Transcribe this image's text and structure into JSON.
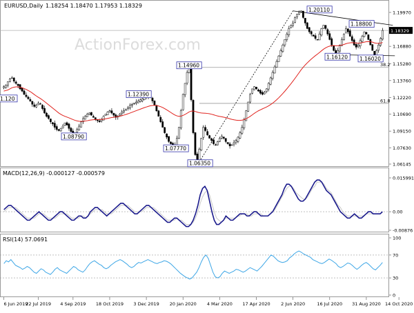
{
  "chart_data": [
    {
      "type": "candlestick",
      "panel": "price",
      "header": {
        "title": "EURUSD,Daily",
        "ohlc": "1.18254 1.18470 1.17953 1.18329"
      },
      "watermark": "ActionForex.com",
      "y_ticks": [
        "1.19970",
        "1.18329",
        "1.16880",
        "1.15280",
        "1.13760",
        "1.12220",
        "1.10690",
        "1.09150",
        "1.07630",
        "1.06145"
      ],
      "current_price_label": "1.18329",
      "ylim": [
        1.06145,
        1.1997
      ],
      "annotations": [
        {
          "text": "1.20110",
          "value": 1.2011
        },
        {
          "text": "1.18800",
          "value": 1.188
        },
        {
          "text": "1.16120",
          "value": 1.1612
        },
        {
          "text": "1.16020",
          "value": 1.1602
        },
        {
          "text": "1.14960",
          "value": 1.1496
        },
        {
          "text": "1.12390",
          "value": 1.1239
        },
        {
          "text": "1.08790",
          "value": 1.0879
        },
        {
          "text": "1.07770",
          "value": 1.0777
        },
        {
          "text": "1.06350",
          "value": 1.0635
        },
        {
          "text": "1.120",
          "value": 1.12
        }
      ],
      "fibonacci": [
        {
          "text": "38.2",
          "value": 1.1496
        },
        {
          "text": "61.8",
          "value": 1.1168
        }
      ],
      "series": [
        {
          "name": "close",
          "values": [
            1.132,
            1.1335,
            1.1365,
            1.139,
            1.14,
            1.137,
            1.135,
            1.133,
            1.13,
            1.128,
            1.125,
            1.123,
            1.121,
            1.119,
            1.116,
            1.114,
            1.115,
            1.117,
            1.116,
            1.112,
            1.108,
            1.105,
            1.103,
            1.1,
            1.098,
            1.095,
            1.093,
            1.092,
            1.094,
            1.096,
            1.099,
            1.097,
            1.094,
            1.091,
            1.089,
            1.09,
            1.093,
            1.096,
            1.1,
            1.103,
            1.105,
            1.107,
            1.108,
            1.106,
            1.104,
            1.102,
            1.101,
            1.1,
            1.102,
            1.105,
            1.107,
            1.109,
            1.11,
            1.108,
            1.106,
            1.104,
            1.105,
            1.107,
            1.109,
            1.11,
            1.111,
            1.113,
            1.115,
            1.116,
            1.117,
            1.118,
            1.119,
            1.12,
            1.121,
            1.122,
            1.1225,
            1.123,
            1.122,
            1.119,
            1.115,
            1.11,
            1.105,
            1.1,
            1.095,
            1.09,
            1.086,
            1.082,
            1.08,
            1.078,
            1.079,
            1.085,
            1.095,
            1.11,
            1.125,
            1.135,
            1.145,
            1.1496,
            1.12,
            1.09,
            1.07,
            1.0635,
            1.075,
            1.085,
            1.095,
            1.092,
            1.088,
            1.085,
            1.083,
            1.08,
            1.079,
            1.082,
            1.085,
            1.087,
            1.085,
            1.082,
            1.08,
            1.078,
            1.079,
            1.081,
            1.083,
            1.086,
            1.09,
            1.095,
            1.102,
            1.11,
            1.118,
            1.125,
            1.13,
            1.132,
            1.13,
            1.128,
            1.126,
            1.125,
            1.127,
            1.13,
            1.135,
            1.14,
            1.145,
            1.15,
            1.155,
            1.16,
            1.165,
            1.17,
            1.175,
            1.18,
            1.185,
            1.188,
            1.19,
            1.195,
            1.198,
            1.2,
            1.2011,
            1.195,
            1.19,
            1.185,
            1.182,
            1.18,
            1.178,
            1.176,
            1.175,
            1.18,
            1.185,
            1.188,
            1.185,
            1.18,
            1.175,
            1.17,
            1.165,
            1.1612,
            1.165,
            1.17,
            1.175,
            1.18,
            1.185,
            1.182,
            1.178,
            1.174,
            1.17,
            1.168,
            1.17,
            1.174,
            1.178,
            1.182,
            1.18,
            1.175,
            1.17,
            1.165,
            1.1602,
            1.165,
            1.17,
            1.176,
            1.1833
          ]
        }
      ],
      "moving_average": {
        "values": [
          1.128,
          1.1285,
          1.129,
          1.13,
          1.131,
          1.1315,
          1.1318,
          1.1318,
          1.1315,
          1.131,
          1.1303,
          1.1295,
          1.1285,
          1.1275,
          1.1262,
          1.1248,
          1.1235,
          1.1223,
          1.1212,
          1.1199,
          1.1185,
          1.117,
          1.1155,
          1.114,
          1.1125,
          1.111,
          1.1095,
          1.108,
          1.1068,
          1.1058,
          1.105,
          1.1043,
          1.1036,
          1.1028,
          1.102,
          1.1013,
          1.1008,
          1.1005,
          1.1004,
          1.1005,
          1.1007,
          1.101,
          1.1014,
          1.1017,
          1.1019,
          1.102,
          1.1021,
          1.1021,
          1.1022,
          1.1024,
          1.1027,
          1.1031,
          1.1035,
          1.1039,
          1.1042,
          1.1044,
          1.1047,
          1.1051,
          1.1056,
          1.1061,
          1.1067,
          1.1073,
          1.108,
          1.1087,
          1.1094,
          1.1101,
          1.1108,
          1.1115,
          1.1122,
          1.1129,
          1.1135,
          1.1141,
          1.1146,
          1.1149,
          1.115,
          1.1148,
          1.1144,
          1.1138,
          1.113,
          1.112,
          1.1109,
          1.1097,
          1.1085,
          1.1073,
          1.1062,
          1.1054,
          1.105,
          1.1052,
          1.1058,
          1.1067,
          1.1078,
          1.109,
          1.1097,
          1.1098,
          1.1094,
          1.1088,
          1.1083,
          1.108,
          1.1079,
          1.1078,
          1.1076,
          1.1073,
          1.1069,
          1.1064,
          1.1058,
          1.1053,
          1.1049,
          1.1046,
          1.1042,
          1.1038,
          1.1033,
          1.1027,
          1.1022,
          1.1018,
          1.1015,
          1.1013,
          1.1013,
          1.1015,
          1.102,
          1.1028,
          1.1038,
          1.105,
          1.1063,
          1.1077,
          1.1089,
          1.11,
          1.1109,
          1.1118,
          1.1126,
          1.1135,
          1.1145,
          1.1157,
          1.117,
          1.1185,
          1.1201,
          1.1219,
          1.1238,
          1.1258,
          1.1279,
          1.1301,
          1.1324,
          1.1347,
          1.1371,
          1.1396,
          1.1422,
          1.1448,
          1.1474,
          1.1497,
          1.1518,
          1.1537,
          1.1555,
          1.1572,
          1.1588,
          1.1603,
          1.1617,
          1.1632,
          1.1647,
          1.1662,
          1.1674,
          1.1683,
          1.169,
          1.1694,
          1.1695,
          1.1693,
          1.1693,
          1.1695,
          1.1699,
          1.1705,
          1.1712,
          1.1717,
          1.172,
          1.1721,
          1.172,
          1.1718,
          1.1717,
          1.1718,
          1.1721,
          1.1726,
          1.173,
          1.1731,
          1.173,
          1.1726,
          1.1719,
          1.1716,
          1.1715,
          1.1717,
          1.1723
        ]
      },
      "trendlines": [
        {
          "from": {
            "i": 96,
            "v": 1.0635
          },
          "to": {
            "i": 142,
            "v": 1.2011
          },
          "style": "dotted"
        },
        {
          "from": {
            "i": 142,
            "v": 1.2011
          },
          "to": {
            "i": 191,
            "v": 1.188
          },
          "style": "solid"
        },
        {
          "from": {
            "i": 160,
            "v": 1.1612
          },
          "to": {
            "i": 192,
            "v": 1.1602
          },
          "style": "solid"
        }
      ]
    },
    {
      "type": "line",
      "panel": "macd",
      "header": "MACD(12,26,9) -0.000127 -0.000579",
      "y_ticks": [
        "0.015991",
        "0.00",
        "-0.00876"
      ],
      "ylim": [
        -0.00876,
        0.015991
      ],
      "series": [
        {
          "name": "macd",
          "values": [
            0.001,
            0.002,
            0.003,
            0.003,
            0.002,
            0.001,
            0.0,
            -0.001,
            -0.002,
            -0.003,
            -0.004,
            -0.004,
            -0.003,
            -0.002,
            -0.001,
            0.0,
            -0.001,
            -0.002,
            -0.003,
            -0.004,
            -0.004,
            -0.003,
            -0.002,
            -0.001,
            0.0,
            0.0,
            -0.001,
            -0.002,
            -0.003,
            -0.004,
            -0.004,
            -0.003,
            -0.002,
            -0.002,
            -0.003,
            -0.003,
            -0.002,
            0.0,
            0.001,
            0.002,
            0.002,
            0.001,
            0.0,
            -0.001,
            -0.002,
            -0.001,
            0.0,
            0.001,
            0.002,
            0.003,
            0.004,
            0.004,
            0.003,
            0.002,
            0.001,
            0.0,
            -0.001,
            -0.001,
            0.0,
            0.001,
            0.002,
            0.003,
            0.003,
            0.002,
            0.001,
            0.0,
            -0.001,
            -0.002,
            -0.003,
            -0.004,
            -0.005,
            -0.005,
            -0.004,
            -0.003,
            -0.003,
            -0.004,
            -0.005,
            -0.006,
            -0.007,
            -0.007,
            -0.006,
            -0.004,
            -0.001,
            0.003,
            0.008,
            0.011,
            0.012,
            0.01,
            0.005,
            0.0,
            -0.004,
            -0.006,
            -0.006,
            -0.005,
            -0.004,
            -0.002,
            -0.003,
            -0.004,
            -0.004,
            -0.003,
            -0.002,
            -0.001,
            -0.001,
            -0.001,
            -0.002,
            -0.002,
            -0.001,
            0.0,
            0.0,
            -0.001,
            -0.002,
            -0.002,
            -0.002,
            -0.002,
            -0.001,
            0.0,
            0.002,
            0.004,
            0.006,
            0.008,
            0.011,
            0.013,
            0.013,
            0.012,
            0.01,
            0.008,
            0.006,
            0.005,
            0.005,
            0.006,
            0.008,
            0.01,
            0.012,
            0.014,
            0.015,
            0.015,
            0.014,
            0.012,
            0.01,
            0.009,
            0.008,
            0.006,
            0.004,
            0.002,
            0.0,
            -0.001,
            -0.002,
            -0.003,
            -0.003,
            -0.002,
            -0.001,
            -0.002,
            -0.003,
            -0.003,
            -0.002,
            -0.001,
            0.0,
            0.0,
            -0.001,
            -0.001,
            -0.001,
            -0.001,
            0.0
          ]
        },
        {
          "name": "signal",
          "values": [
            0.0,
            0.001,
            0.002,
            0.002,
            0.002,
            0.002,
            0.001,
            0.0,
            -0.001,
            -0.002,
            -0.003,
            -0.003,
            -0.003,
            -0.003,
            -0.002,
            -0.001,
            -0.001,
            -0.001,
            -0.002,
            -0.003,
            -0.003,
            -0.003,
            -0.003,
            -0.002,
            -0.001,
            -0.001,
            -0.001,
            -0.001,
            -0.002,
            -0.003,
            -0.003,
            -0.003,
            -0.003,
            -0.002,
            -0.002,
            -0.003,
            -0.002,
            -0.001,
            0.0,
            0.001,
            0.001,
            0.001,
            0.001,
            0.0,
            -0.001,
            -0.001,
            -0.001,
            0.0,
            0.001,
            0.002,
            0.003,
            0.003,
            0.003,
            0.003,
            0.002,
            0.001,
            0.0,
            0.0,
            0.0,
            0.0,
            0.001,
            0.002,
            0.002,
            0.002,
            0.002,
            0.001,
            0.0,
            -0.001,
            -0.002,
            -0.003,
            -0.004,
            -0.004,
            -0.004,
            -0.004,
            -0.003,
            -0.004,
            -0.004,
            -0.005,
            -0.006,
            -0.006,
            -0.006,
            -0.005,
            -0.003,
            0.0,
            0.004,
            0.007,
            0.009,
            0.01,
            0.008,
            0.004,
            0.0,
            -0.003,
            -0.004,
            -0.005,
            -0.004,
            -0.003,
            -0.003,
            -0.003,
            -0.003,
            -0.003,
            -0.002,
            -0.002,
            -0.001,
            -0.001,
            -0.001,
            -0.002,
            -0.002,
            -0.001,
            -0.001,
            -0.001,
            -0.001,
            -0.002,
            -0.002,
            -0.002,
            -0.001,
            0.0,
            0.001,
            0.003,
            0.005,
            0.007,
            0.009,
            0.011,
            0.012,
            0.012,
            0.011,
            0.009,
            0.008,
            0.007,
            0.006,
            0.006,
            0.007,
            0.009,
            0.011,
            0.012,
            0.014,
            0.014,
            0.014,
            0.013,
            0.011,
            0.01,
            0.009,
            0.007,
            0.005,
            0.003,
            0.002,
            0.0,
            -0.001,
            -0.002,
            -0.002,
            -0.002,
            -0.002,
            -0.002,
            -0.002,
            -0.002,
            -0.002,
            -0.001,
            -0.001,
            -0.001,
            -0.001,
            -0.001,
            -0.001,
            -0.001
          ]
        }
      ]
    },
    {
      "type": "line",
      "panel": "rsi",
      "header": "RSI(14) 57.0691",
      "y_ticks": [
        "100",
        "70",
        "30",
        "0"
      ],
      "ylim": [
        0,
        100
      ],
      "levels": [
        70,
        30
      ],
      "series": [
        {
          "name": "rsi",
          "values": [
            55,
            60,
            58,
            62,
            57,
            52,
            50,
            48,
            45,
            47,
            50,
            48,
            44,
            40,
            38,
            42,
            46,
            44,
            40,
            38,
            36,
            40,
            45,
            48,
            44,
            42,
            40,
            38,
            42,
            46,
            50,
            48,
            44,
            42,
            40,
            44,
            50,
            55,
            58,
            60,
            57,
            54,
            52,
            48,
            46,
            48,
            52,
            55,
            58,
            60,
            62,
            60,
            57,
            54,
            50,
            48,
            50,
            54,
            57,
            56,
            58,
            60,
            62,
            60,
            58,
            56,
            55,
            57,
            58,
            60,
            59,
            57,
            54,
            50,
            46,
            42,
            38,
            35,
            32,
            30,
            28,
            30,
            35,
            40,
            48,
            58,
            66,
            70,
            64,
            52,
            40,
            32,
            30,
            32,
            38,
            42,
            40,
            38,
            40,
            42,
            45,
            44,
            42,
            40,
            42,
            45,
            48,
            46,
            44,
            42,
            46,
            50,
            55,
            60,
            65,
            70,
            68,
            64,
            60,
            58,
            57,
            58,
            60,
            65,
            68,
            72,
            75,
            77,
            75,
            72,
            70,
            68,
            66,
            62,
            60,
            58,
            56,
            55,
            57,
            60,
            63,
            61,
            58,
            55,
            50,
            48,
            50,
            53,
            56,
            55,
            52,
            48,
            45,
            48,
            52,
            55,
            57,
            54,
            50,
            46,
            44,
            48,
            52,
            57
          ]
        }
      ]
    }
  ],
  "x_ticks": [
    {
      "label": "6 Jun 2019",
      "i": 0
    },
    {
      "label": "22 Jul 2019",
      "i": 17
    },
    {
      "label": "4 Sep 2019",
      "i": 34
    },
    {
      "label": "18 Oct 2019",
      "i": 52
    },
    {
      "label": "3 Dec 2019",
      "i": 70
    },
    {
      "label": "20 Jan 2020",
      "i": 88
    },
    {
      "label": "4 Mar 2020",
      "i": 106
    },
    {
      "label": "17 Apr 2020",
      "i": 124
    },
    {
      "label": "2 Jun 2020",
      "i": 142
    },
    {
      "label": "16 Jul 2020",
      "i": 160
    },
    {
      "label": "31 Aug 2020",
      "i": 178
    },
    {
      "label": "14 Oct 2020",
      "i": 194
    }
  ],
  "colors": {
    "candle_up": "#ffffff",
    "candle_down": "#000000",
    "candle_edge": "#000000",
    "moving_average": "#e0201b",
    "macd": "#1a1a8c",
    "signal": "#c8c8c8",
    "rsi": "#3da6e6",
    "label_border": "#3333aa",
    "grid_level": "#999999"
  }
}
